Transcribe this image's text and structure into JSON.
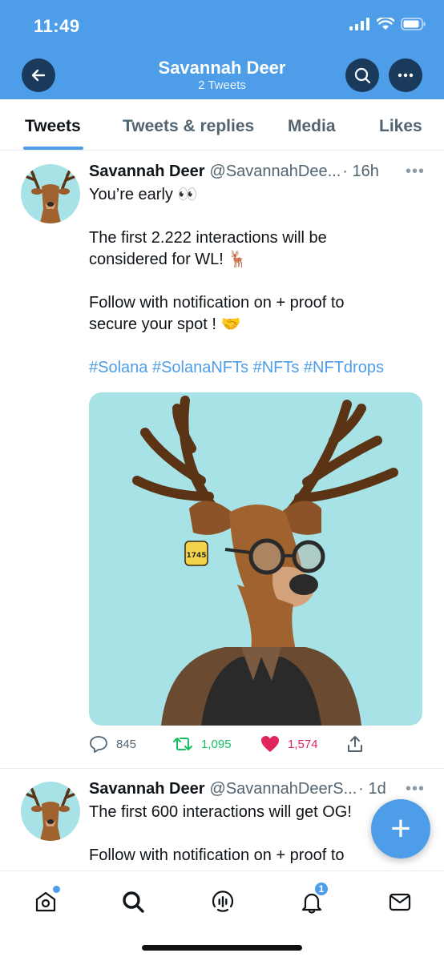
{
  "status_bar": {
    "time": "11:49"
  },
  "header": {
    "title": "Savannah Deer",
    "subtitle": "2 Tweets",
    "back_icon": "arrow-left-icon",
    "search_icon": "search-icon",
    "more_icon": "more-horizontal-icon"
  },
  "tabs": [
    {
      "label": "Tweets",
      "active": true
    },
    {
      "label": "Tweets & replies",
      "active": false
    },
    {
      "label": "Media",
      "active": false
    },
    {
      "label": "Likes",
      "active": false
    }
  ],
  "tweets": [
    {
      "name": "Savannah Deer",
      "handle": "@SavannahDee...",
      "time": "· 16h",
      "more": "•••",
      "lines": [
        "You’re early 👀",
        "",
        "The first 2.222 interactions will be",
        "considered for WL! 🦌",
        "",
        "Follow with notification on + proof to",
        "secure your spot ! 🤝",
        ""
      ],
      "hashtags": "#Solana #SolanaNFTs #NFTs #NFTdrops",
      "image_tag": "1745",
      "replies": "845",
      "retweets": "1,095",
      "likes": "1,574"
    },
    {
      "name": "Savannah Deer",
      "handle": "@SavannahDeerS...",
      "time": "· 1d",
      "more": "•••",
      "lines": [
        "The first 600 interactions will get OG!",
        "",
        "Follow with notification on + proof to"
      ]
    }
  ],
  "fab": {
    "label": "+"
  },
  "bottom_nav": {
    "items": [
      "home-icon",
      "search-icon",
      "spaces-icon",
      "notifications-icon",
      "messages-icon"
    ],
    "notification_count": "1"
  },
  "colors": {
    "header": "#4d9de8",
    "accent": "#4d9de8",
    "retweet": "#17bf63",
    "like": "#e0245e",
    "image_bg": "#a7e3e6"
  }
}
